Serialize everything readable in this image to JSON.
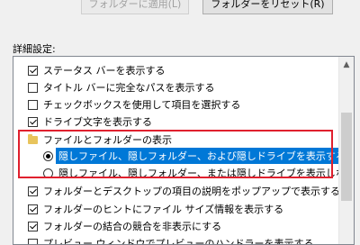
{
  "buttons": {
    "reset_folders": "フォルダーに適用(L)",
    "apply_to_folders": "フォルダーをリセット(R)"
  },
  "advanced_label": "詳細設定:",
  "settings": [
    {
      "type": "checkbox",
      "checked": true,
      "label": "ステータス バーを表示する"
    },
    {
      "type": "checkbox",
      "checked": false,
      "label": "タイトル バーに完全なパスを表示する"
    },
    {
      "type": "checkbox",
      "checked": false,
      "label": "チェックボックスを使用して項目を選択する"
    },
    {
      "type": "checkbox",
      "checked": true,
      "label": "ドライブ文字を表示する"
    },
    {
      "type": "folder",
      "label": "ファイルとフォルダーの表示"
    },
    {
      "type": "radio",
      "checked": true,
      "selected": true,
      "label": "隠しファイル、隠しフォルダー、および隠しドライブを表示する"
    },
    {
      "type": "radio",
      "checked": false,
      "label": "隠しファイル、隠しフォルダー、または隠しドライブを表示しない"
    },
    {
      "type": "checkbox",
      "checked": true,
      "label": "フォルダーとデスクトップの項目の説明をポップアップで表示する"
    },
    {
      "type": "checkbox",
      "checked": true,
      "label": "フォルダーのヒントにファイル サイズ情報を表示する"
    },
    {
      "type": "checkbox",
      "checked": true,
      "label": "フォルダーの結合の競合を非表示にする"
    },
    {
      "type": "checkbox",
      "checked": false,
      "label": "プレビュー ウィンドウでプレビューのハンドラーを表示する"
    }
  ],
  "colors": {
    "selection": "#0078d7",
    "highlight_box": "#e0202e"
  }
}
